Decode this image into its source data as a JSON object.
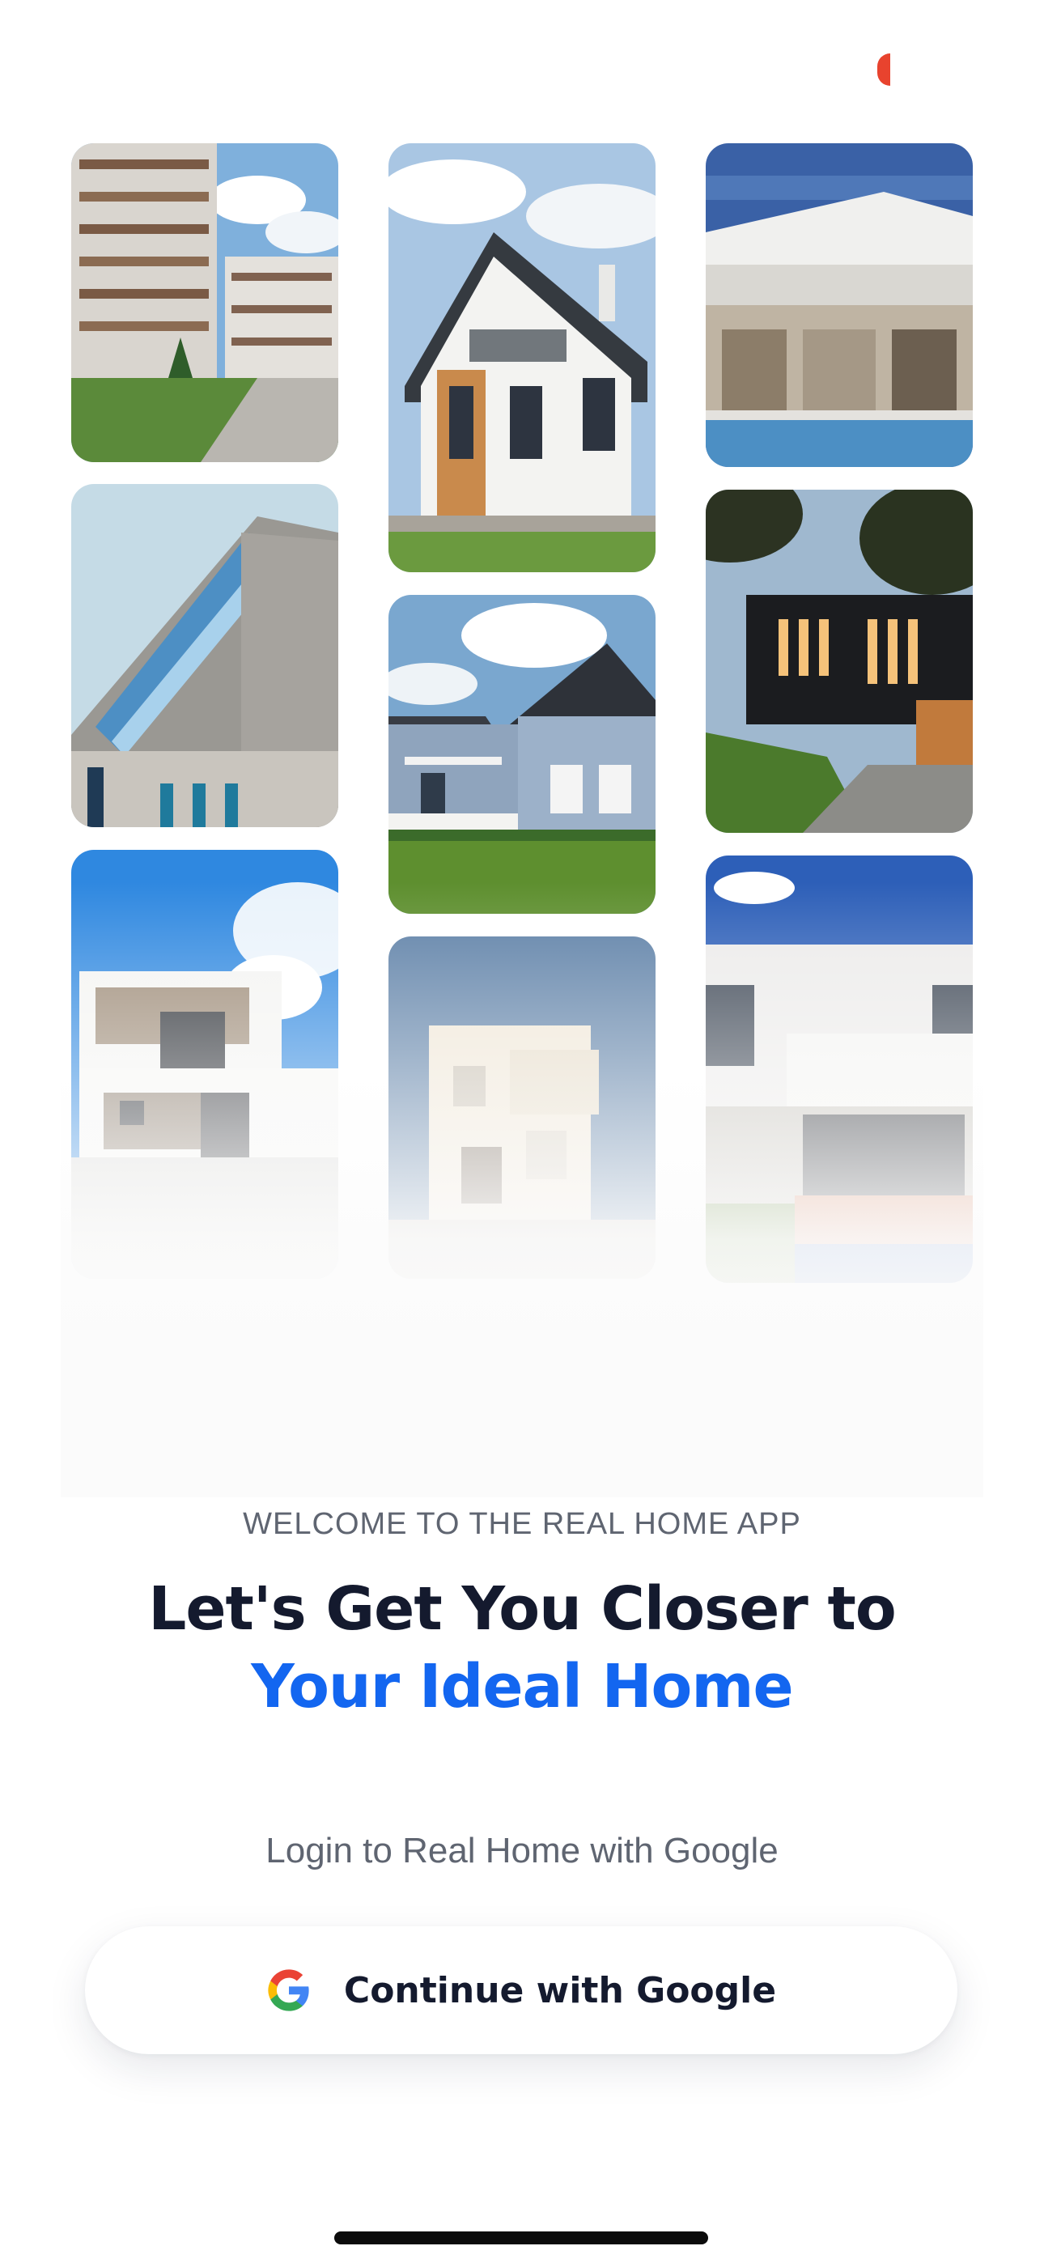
{
  "status_bar": {
    "recording_indicator_color": "#e8432e"
  },
  "gallery": {
    "images": [
      {
        "name": "apartment-complex-photo"
      },
      {
        "name": "gabled-white-house-photo"
      },
      {
        "name": "modern-pool-villa-photo"
      },
      {
        "name": "striped-facade-building-photo"
      },
      {
        "name": "blue-siding-house-photo"
      },
      {
        "name": "black-box-house-night-photo"
      },
      {
        "name": "white-modern-house-photo"
      },
      {
        "name": "cream-cube-house-photo"
      },
      {
        "name": "flat-roof-white-building-photo"
      }
    ]
  },
  "onboarding": {
    "eyebrow": "WELCOME TO THE REAL HOME APP",
    "headline_line1": "Let's Get You Closer to",
    "headline_line2": "Your Ideal Home",
    "login_hint": "Login to Real Home with Google"
  },
  "google_button": {
    "label": "Continue with Google",
    "icon": "google-g-icon"
  },
  "colors": {
    "accent": "#1366f0",
    "headline": "#141a2e",
    "muted_text": "#5f6571"
  }
}
